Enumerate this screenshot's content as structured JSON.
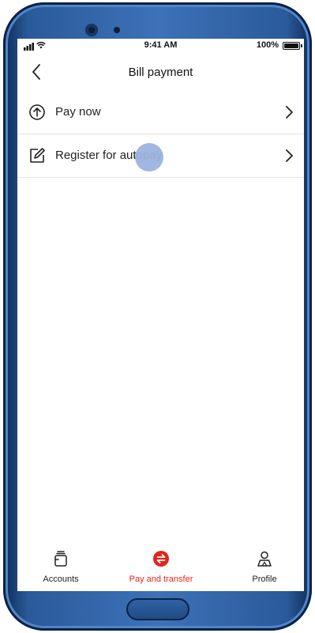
{
  "status_bar": {
    "time": "9:41 AM",
    "battery_percent": "100%",
    "battery_level": 1.0,
    "signal_icon": "signal-bars-icon",
    "wifi_icon": "wifi-icon"
  },
  "header": {
    "title": "Bill payment",
    "back_icon": "chevron-left-icon"
  },
  "menu": [
    {
      "label": "Pay now",
      "icon": "arrow-up-circle-icon"
    },
    {
      "label": "Register for autopay",
      "icon": "edit-icon"
    }
  ],
  "tabbar": {
    "items": [
      {
        "label": "Accounts",
        "icon": "wallet-icon",
        "active": false
      },
      {
        "label": "Pay and transfer",
        "icon": "transfer-icon",
        "active": true
      },
      {
        "label": "Profile",
        "icon": "user-icon",
        "active": false
      }
    ]
  },
  "colors": {
    "accent": "#e5231b",
    "text": "#222222",
    "divider": "#e3e3e3",
    "touch_indicator": "#9db3dd",
    "device_frame": "#3d72b8"
  }
}
